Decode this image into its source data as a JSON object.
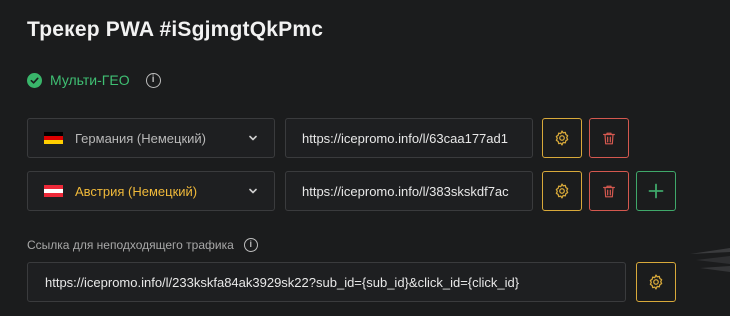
{
  "page": {
    "title": "Трекер PWA #iSgjmgtQkPmc"
  },
  "multigeo": {
    "label": "Мульти-ГЕО",
    "enabled": true,
    "status_color": "#3fbf73"
  },
  "geo_rows": [
    {
      "country": "Германия (Немецкий)",
      "flag_colors": [
        "#000000",
        "#dd0000",
        "#ffce00"
      ],
      "url": "https://icepromo.info/l/63caa177ad1",
      "active": false
    },
    {
      "country": "Австрия (Немецкий)",
      "flag_colors": [
        "#ed2939",
        "#ffffff",
        "#ed2939"
      ],
      "url": "https://icepromo.info/l/383skskdf7ac",
      "active": true
    }
  ],
  "fallback": {
    "label": "Ссылка для неподходящего трафика",
    "url": "https://icepromo.info/l/233kskfa84ak3929sk22?sub_id={sub_id}&click_id={click_id}"
  },
  "icons": {
    "settings": "gear-icon",
    "delete": "trash-icon",
    "add": "plus-icon",
    "dropdown": "chevron-down-icon",
    "info": "info-icon",
    "check": "check-circle-icon"
  },
  "colors": {
    "accent_gear": "#d8a93a",
    "accent_delete": "#d4584f",
    "accent_add": "#3fa86a",
    "active_select_text": "#f0b93a"
  }
}
